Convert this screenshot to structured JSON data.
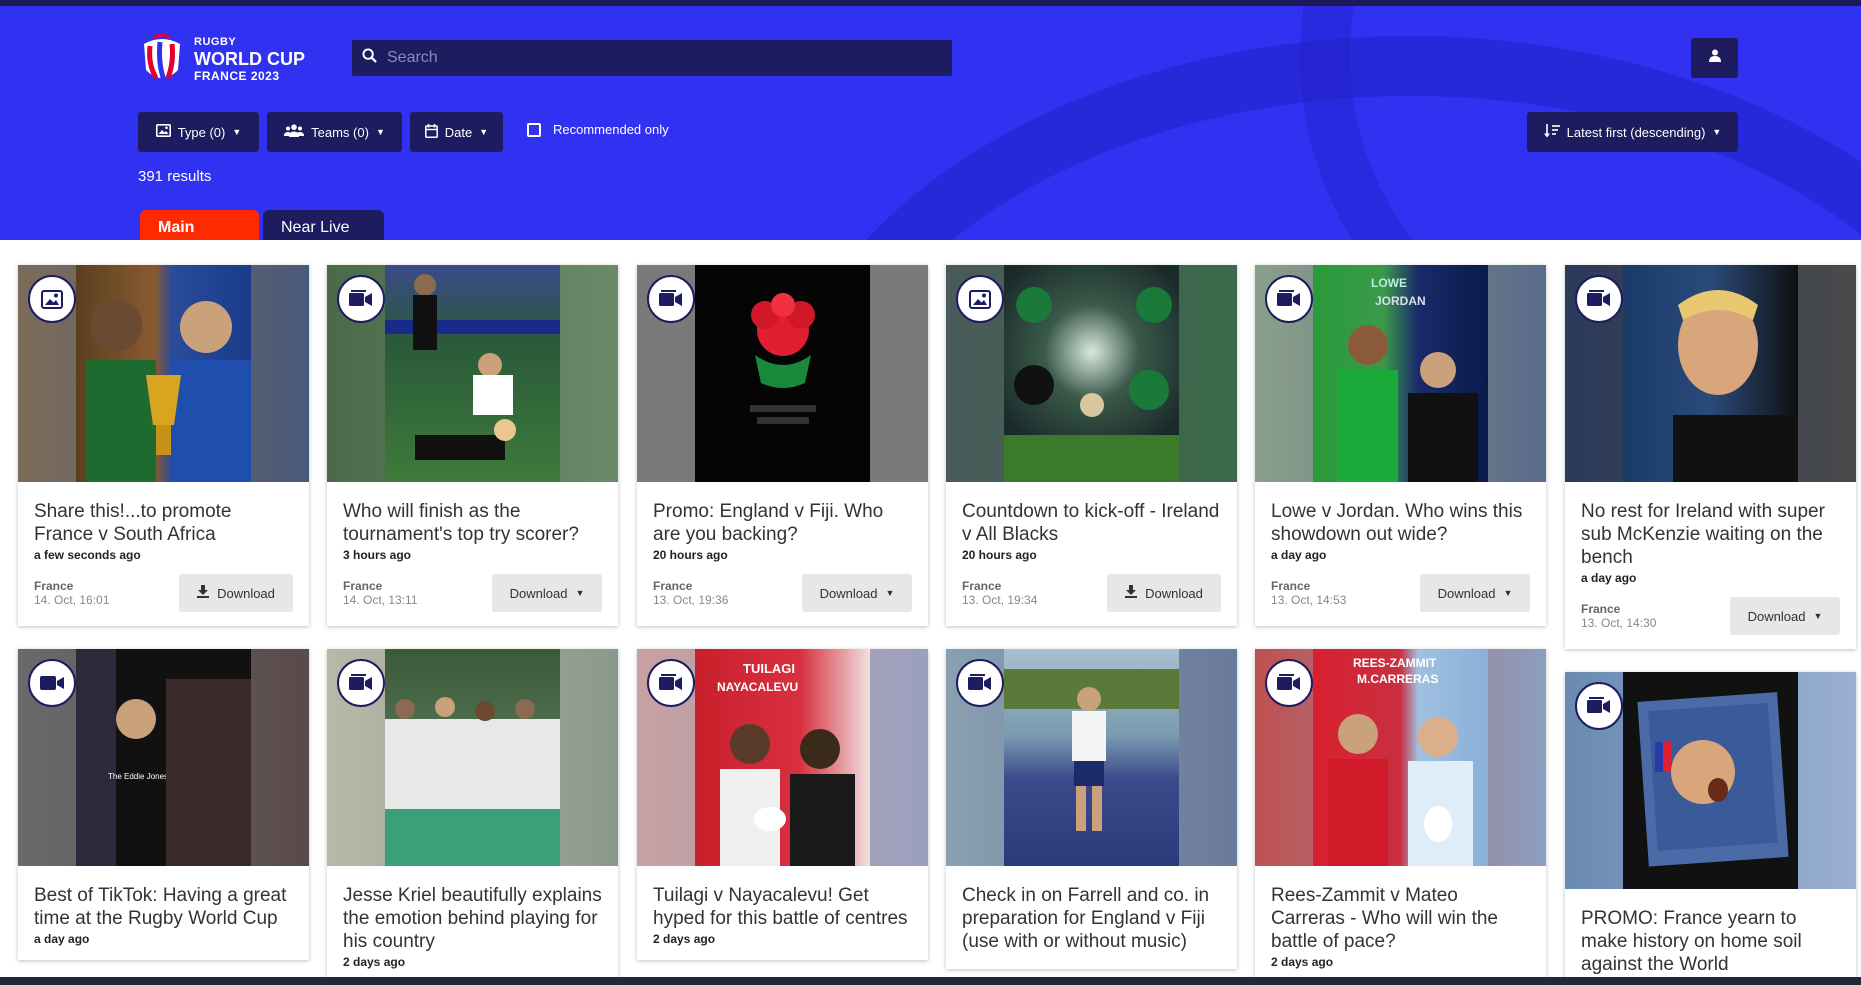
{
  "brand": {
    "line1": "RUGBY",
    "line2": "WORLD CUP",
    "line3": "FRANCE 2023"
  },
  "search": {
    "placeholder": "Search"
  },
  "filters": {
    "type": "Type (0)",
    "teams": "Teams (0)",
    "date": "Date",
    "recommended": "Recommended only",
    "sort": "Latest first (descending)"
  },
  "results_count": "391 results",
  "tabs": {
    "main": "Main",
    "near_live": "Near Live"
  },
  "cards": [
    {
      "title": "Share this!...to promote France v South Africa",
      "time": "a few seconds ago",
      "team": "France",
      "date": "14. Oct, 16:01",
      "download": "Download",
      "media": "image-icon"
    },
    {
      "title": "Who will finish as the tournament's top try scorer?",
      "time": "3 hours ago",
      "team": "France",
      "date": "14. Oct, 13:11",
      "download": "Download",
      "media": "video-multi-icon"
    },
    {
      "title": "Promo: England v Fiji. Who are you backing?",
      "time": "20 hours ago",
      "team": "France",
      "date": "13. Oct, 19:36",
      "download": "Download",
      "media": "video-multi-icon"
    },
    {
      "title": "Countdown to kick-off - Ireland v All Blacks",
      "time": "20 hours ago",
      "team": "France",
      "date": "13. Oct, 19:34",
      "download": "Download",
      "media": "image-icon"
    },
    {
      "title": "Lowe v Jordan. Who wins this showdown out wide?",
      "time": "a day ago",
      "team": "France",
      "date": "13. Oct, 14:53",
      "download": "Download",
      "media": "video-multi-icon"
    },
    {
      "title": "No rest for Ireland with super sub McKenzie waiting on the bench",
      "time": "a day ago",
      "team": "France",
      "date": "13. Oct, 14:30",
      "download": "Download",
      "media": "video-multi-icon"
    },
    {
      "title": "Best of TikTok: Having a great time at the Rugby World Cup",
      "time": "a day ago",
      "media": "video-icon"
    },
    {
      "title": "Jesse Kriel beautifully explains the emotion behind playing for his country",
      "time": "2 days ago",
      "media": "video-multi-icon"
    },
    {
      "title": "Tuilagi v Nayacalevu! Get hyped for this battle of centres",
      "time": "2 days ago",
      "media": "video-multi-icon"
    },
    {
      "title": "Check in on Farrell and co. in preparation for England v Fiji (use with or without music)",
      "time": "",
      "media": "video-multi-icon"
    },
    {
      "title": "Rees-Zammit v Mateo Carreras - Who will win the battle of pace?",
      "time": "2 days ago",
      "media": "video-multi-icon"
    },
    {
      "title": "PROMO: France yearn to make history on home soil against the World",
      "time": "",
      "media": "video-multi-icon"
    }
  ],
  "thumb_text": {
    "c4a": "LOWE",
    "c4b": "JORDAN",
    "c6": "The Eddie Jones Effect",
    "c8a": "TUILAGI",
    "c8b": "NAYACALEVU",
    "c10a": "REES-ZAMMIT",
    "c10b": "M.CARRERAS"
  },
  "colors": {
    "header_bg": "#3131f2",
    "dark_navy": "#1c1c5e",
    "tab_active": "#ff2a00"
  }
}
